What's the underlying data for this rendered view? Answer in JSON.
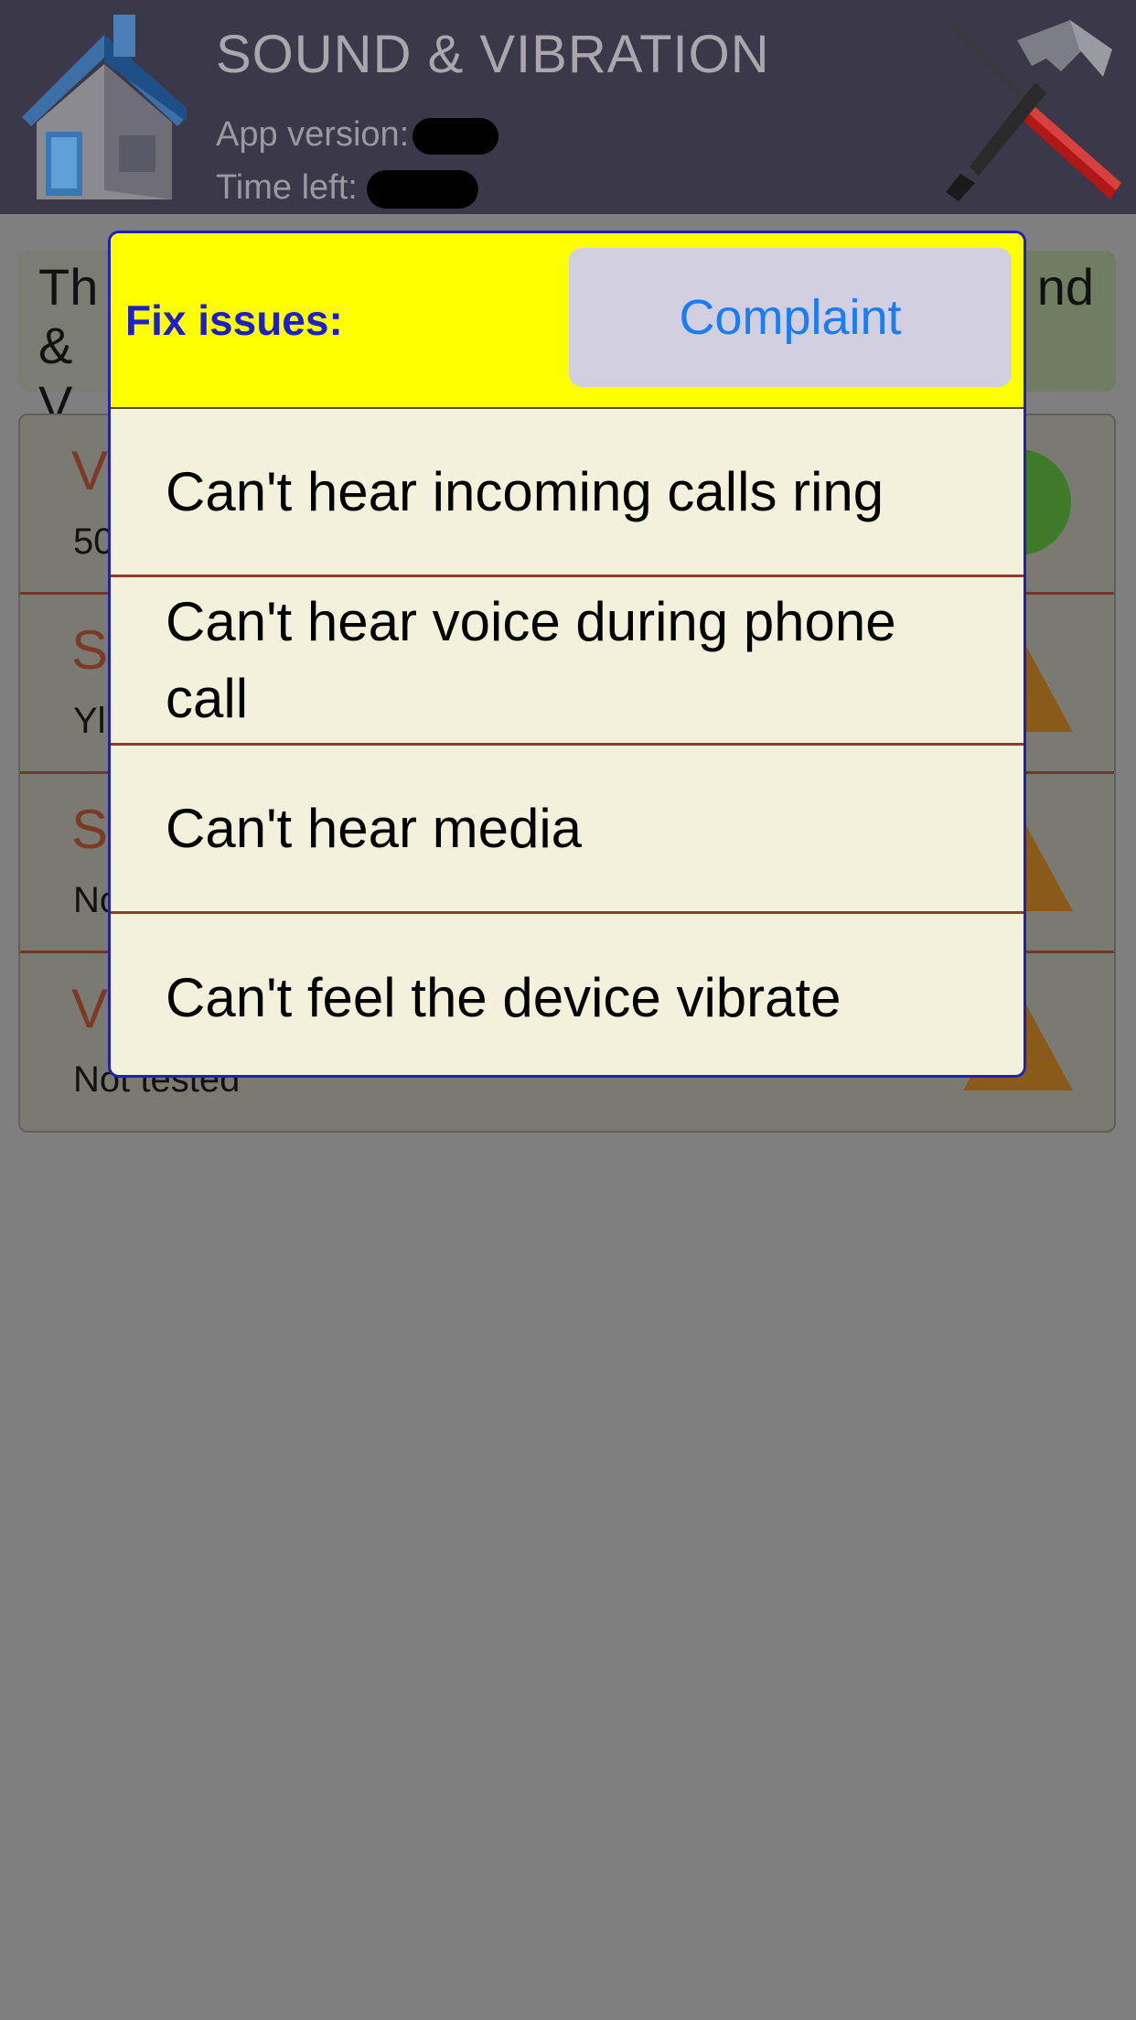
{
  "header": {
    "title": "SOUND & VIBRATION",
    "app_version_label": "App version:",
    "time_left_label": "Time left:",
    "home_icon": "house-icon",
    "tools_icon": "hammer-screwdriver-icon"
  },
  "background": {
    "banner_left": "Th & V",
    "banner_right": "nd",
    "rows": [
      {
        "title": "V",
        "sub": "50",
        "icon": "green-check-icon"
      },
      {
        "title": "S",
        "sub": "Yl",
        "icon": "warning-triangle-icon"
      },
      {
        "title": "S",
        "sub": "No",
        "icon": "warning-triangle-icon"
      },
      {
        "title": "V",
        "sub": "Not tested",
        "icon": "warning-triangle-icon"
      }
    ]
  },
  "dialog": {
    "title": "Fix issues:",
    "complaint_label": "Complaint",
    "issues": [
      "Can't hear incoming calls ring",
      "Can't hear voice during phone call",
      "Can't hear media",
      "Can't feel the device vibrate"
    ]
  },
  "colors": {
    "header_bg": "#3b3849",
    "dialog_head_bg": "#ffff00",
    "dialog_title": "#1d20c6",
    "complaint_text": "#1b7cf4",
    "overlay": "#7f7f7f"
  }
}
